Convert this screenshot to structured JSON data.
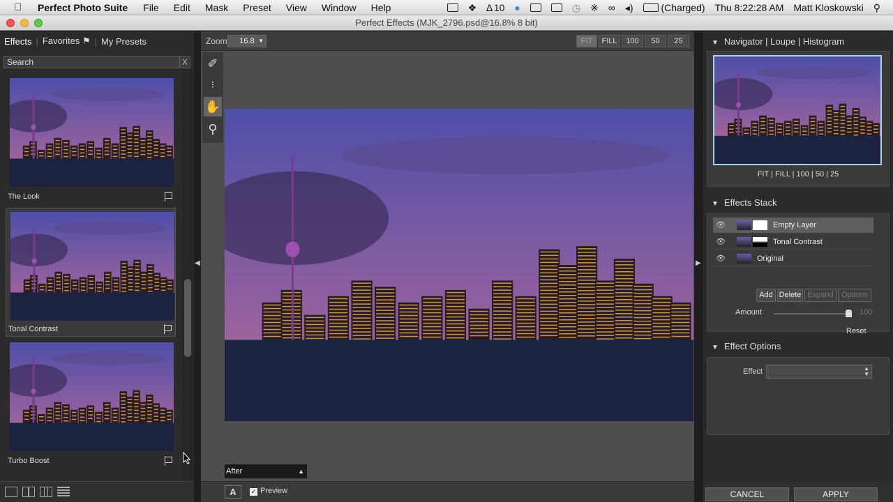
{
  "menubar": {
    "app_name": "Perfect Photo Suite",
    "items": [
      "File",
      "Edit",
      "Mask",
      "Preset",
      "View",
      "Window",
      "Help"
    ],
    "adobe_count": "10",
    "battery": "(Charged)",
    "clock": "Thu 8:22:28 AM",
    "user": "Matt Kloskowski"
  },
  "window": {
    "title": "Perfect Effects (MJK_2796.psd@16.8% 8 bit)"
  },
  "left_panel": {
    "tabs": [
      "Effects",
      "Favorites",
      "My Presets"
    ],
    "search_placeholder": "Search",
    "search_clear": "X",
    "presets": [
      {
        "label": "The Look",
        "selected": false
      },
      {
        "label": "Tonal Contrast",
        "selected": true
      },
      {
        "label": "Turbo Boost",
        "selected": false
      }
    ]
  },
  "canvas": {
    "zoom_label": "Zoom",
    "zoom_value": "16.8",
    "zoom_buttons": [
      "FIT",
      "FILL",
      "100",
      "50",
      "25"
    ],
    "active_zoom": "FIT",
    "view_select": "After",
    "a_button": "A",
    "preview_label": "Preview",
    "preview_checked": true
  },
  "right_panel": {
    "navigator_tabs": "Navigator  |  Loupe  |  Histogram",
    "navigator_zoom": "FIT  |  FILL  |  100  |  50  |  25",
    "effects_stack_title": "Effects Stack",
    "layers": [
      {
        "name": "Empty Layer",
        "selected": true
      },
      {
        "name": "Tonal Contrast",
        "selected": false
      },
      {
        "name": "Original",
        "selected": false
      }
    ],
    "stack_buttons": {
      "add": "Add",
      "delete": "Delete",
      "expand": "Expand",
      "options": "Options"
    },
    "amount_label": "Amount",
    "amount_value": "100",
    "amount_fraction": 1.0,
    "reset_label": "Reset",
    "effect_options_title": "Effect Options",
    "effect_label": "Effect",
    "effect_value": ""
  },
  "footer": {
    "cancel": "CANCEL",
    "apply": "APPLY"
  },
  "colors": {
    "nav_border": "#a9d4f0",
    "sky_top": "#4e4fa8",
    "sky_bottom": "#b86a9a",
    "water": "#1c2340"
  }
}
